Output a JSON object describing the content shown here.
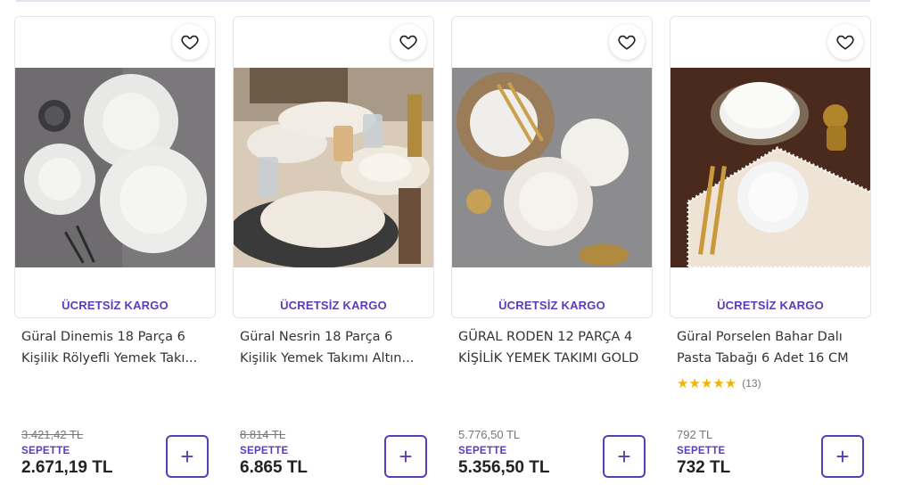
{
  "products": [
    {
      "shipping_badge": "ÜCRETSİZ KARGO",
      "title_line1": "Güral Dinemis 18 Parça 6",
      "title_line2": "Kişilik Rölyefli Yemek Takı...",
      "old_price": "3.421,42 TL",
      "old_price_struck": true,
      "basket_label": "SEPETTE",
      "price": "2.671,19 TL",
      "add_label": "+",
      "image_alt": "white embossed dinner plates on grey surface"
    },
    {
      "shipping_badge": "ÜCRETSİZ KARGO",
      "title_line1": "Güral Nesrin 18 Parça 6",
      "title_line2": "Kişilik Yemek Takımı Altın...",
      "old_price": "8.814 TL",
      "old_price_struck": true,
      "basket_label": "SEPETTE",
      "price": "6.865 TL",
      "add_label": "+",
      "image_alt": "wavy white plates with gold rim on table"
    },
    {
      "shipping_badge": "ÜCRETSİZ KARGO",
      "title_line1": "GÜRAL RODEN 12 PARÇA 4",
      "title_line2": "KİŞİLİK YEMEK TAKIMI GOLD",
      "old_price": "5.776,50 TL",
      "old_price_struck": false,
      "basket_label": "SEPETTE",
      "price": "5.356,50 TL",
      "add_label": "+",
      "image_alt": "white plates with gold cutlery on grey surface"
    },
    {
      "shipping_badge": "ÜCRETSİZ KARGO",
      "title_line1": "Güral Porselen Bahar Dalı",
      "title_line2": "Pasta Tabağı 6 Adet 16 CM",
      "rating_stars": "★★★★★",
      "rating_count": "(13)",
      "old_price": "792 TL",
      "old_price_struck": false,
      "basket_label": "SEPETTE",
      "price": "732 TL",
      "add_label": "+",
      "image_alt": "stack of white cake plates on brown surface with lace napkin"
    }
  ],
  "colors": {
    "accent": "#5b3bb6",
    "star": "#f5b301",
    "text": "#333333",
    "muted": "#777777"
  },
  "icons": {
    "favorite": "heart-outline-icon",
    "add": "plus-icon"
  }
}
